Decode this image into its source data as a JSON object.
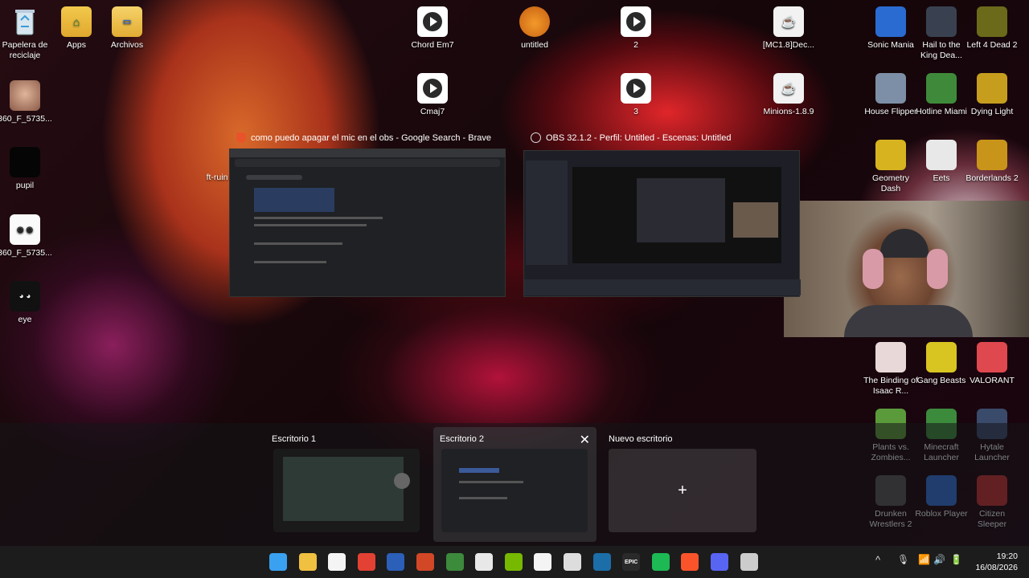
{
  "desktop_left": [
    {
      "label": "Papelera de reciclaje",
      "icon": "recycle-bin-icon"
    },
    {
      "label": "Apps",
      "icon": "folder-icon"
    },
    {
      "label": "Archivos",
      "icon": "folder-icon"
    },
    {
      "label": "360_F_5735...",
      "icon": "image-icon"
    },
    {
      "label": "pupil",
      "icon": "image-icon"
    },
    {
      "label": "360_F_5735...",
      "icon": "image-icon"
    },
    {
      "label": "eye",
      "icon": "image-icon"
    },
    {
      "label": "ft-ruin",
      "icon": "image-icon"
    }
  ],
  "desktop_center": [
    {
      "label": "Chord Em7",
      "icon": "audio-file-icon"
    },
    {
      "label": "untitled",
      "icon": "fl-studio-icon"
    },
    {
      "label": "2",
      "icon": "audio-file-icon"
    },
    {
      "label": "[MC1.8]Dec...",
      "icon": "java-icon"
    },
    {
      "label": "Cmaj7",
      "icon": "audio-file-icon"
    },
    {
      "label": "3",
      "icon": "audio-file-icon"
    },
    {
      "label": "Minions-1.8.9",
      "icon": "java-icon"
    }
  ],
  "desktop_right": [
    {
      "label": "Sonic Mania",
      "icon": "game-icon",
      "color": "#2a6bd1"
    },
    {
      "label": "Hail to the King Dea...",
      "icon": "game-icon",
      "color": "#394150"
    },
    {
      "label": "Left 4 Dead 2",
      "icon": "game-icon",
      "color": "#6b6a1a"
    },
    {
      "label": "House Flipper",
      "icon": "game-icon",
      "color": "#7c8fa6"
    },
    {
      "label": "Hotline Miami",
      "icon": "game-icon",
      "color": "#3f8a3a"
    },
    {
      "label": "Dying Light",
      "icon": "game-icon",
      "color": "#c79d1e"
    },
    {
      "label": "Geometry Dash",
      "icon": "game-icon",
      "color": "#d8b320"
    },
    {
      "label": "Eets",
      "icon": "game-icon",
      "color": "#e8e8e8"
    },
    {
      "label": "Borderlands 2",
      "icon": "game-icon",
      "color": "#c9941a"
    },
    {
      "label": "The Binding of Isaac R...",
      "icon": "game-icon",
      "color": "#e8d8d8"
    },
    {
      "label": "Gang Beasts",
      "icon": "game-icon",
      "color": "#d9c521"
    },
    {
      "label": "VALORANT",
      "icon": "game-icon",
      "color": "#e04850"
    },
    {
      "label": "Plants vs. Zombies...",
      "icon": "game-icon",
      "color": "#5a9a3a"
    },
    {
      "label": "Minecraft Launcher",
      "icon": "game-icon",
      "color": "#3c8a3c"
    },
    {
      "label": "Hytale Launcher",
      "icon": "game-icon",
      "color": "#3a4a6a"
    },
    {
      "label": "Drunken Wrestlers 2",
      "icon": "game-icon",
      "color": "#555"
    },
    {
      "label": "Roblox Player",
      "icon": "game-icon",
      "color": "#2f6fd6"
    },
    {
      "label": "Citizen Sleeper",
      "icon": "game-icon",
      "color": "#c23030"
    }
  ],
  "windows": [
    {
      "title": "como puedo apagar el mic en el obs - Google Search - Brave",
      "icon": "brave-icon"
    },
    {
      "title": "OBS 32.1.2 - Perfil: Untitled - Escenas: Untitled",
      "icon": "obs-icon"
    }
  ],
  "virtual_desktops": [
    {
      "label": "Escritorio 1"
    },
    {
      "label": "Escritorio 2"
    },
    {
      "label": "Nuevo escritorio",
      "plus": "+"
    }
  ],
  "taskbar": {
    "apps": [
      "start-icon",
      "file-explorer-icon",
      "notes-icon",
      "chrome-icon",
      "word-icon",
      "powerpoint-icon",
      "minecraft-icon",
      "notepad-icon",
      "nvidia-icon",
      "capcut-icon",
      "app-icon",
      "steam-icon",
      "epic-games-icon",
      "spotify-icon",
      "brave-icon",
      "discord-icon",
      "obs-icon"
    ],
    "epic_label": "EPIC",
    "time": "19:20",
    "date": "16/08/2026",
    "tray_caret": "^"
  }
}
